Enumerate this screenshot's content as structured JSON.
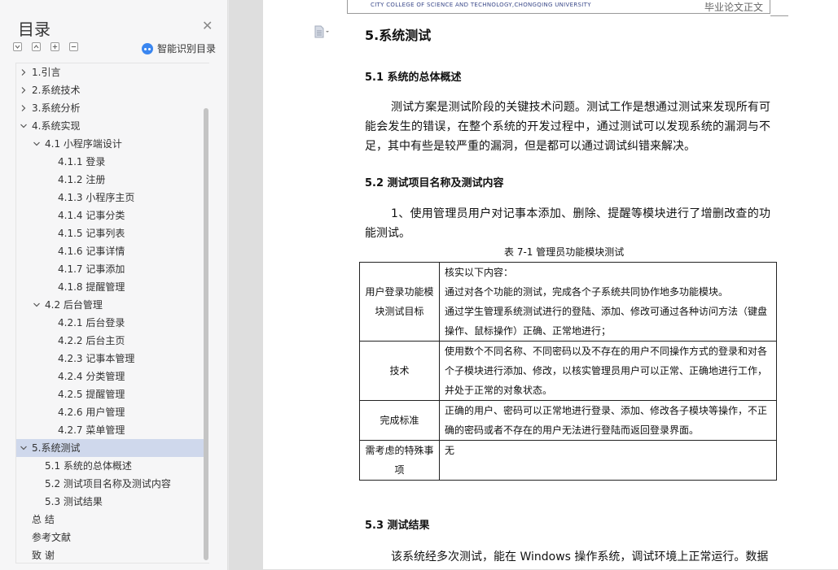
{
  "sidebar": {
    "title": "目录",
    "smart_toc_label": "智能识别目录",
    "toc": [
      {
        "label": "1.引言",
        "level": 1,
        "expandable": true,
        "expanded": false,
        "active": false
      },
      {
        "label": "2.系统技术",
        "level": 1,
        "expandable": true,
        "expanded": false,
        "active": false
      },
      {
        "label": "3.系统分析",
        "level": 1,
        "expandable": true,
        "expanded": false,
        "active": false
      },
      {
        "label": "4.系统实现",
        "level": 1,
        "expandable": true,
        "expanded": true,
        "active": false
      },
      {
        "label": "4.1 小程序端设计",
        "level": 2,
        "expandable": true,
        "expanded": true,
        "active": false
      },
      {
        "label": "4.1.1 登录",
        "level": 3,
        "expandable": false,
        "expanded": false,
        "active": false
      },
      {
        "label": "4.1.2 注册",
        "level": 3,
        "expandable": false,
        "expanded": false,
        "active": false
      },
      {
        "label": "4.1.3 小程序主页",
        "level": 3,
        "expandable": false,
        "expanded": false,
        "active": false
      },
      {
        "label": "4.1.4 记事分类",
        "level": 3,
        "expandable": false,
        "expanded": false,
        "active": false
      },
      {
        "label": "4.1.5 记事列表",
        "level": 3,
        "expandable": false,
        "expanded": false,
        "active": false
      },
      {
        "label": "4.1.6 记事详情",
        "level": 3,
        "expandable": false,
        "expanded": false,
        "active": false
      },
      {
        "label": "4.1.7 记事添加",
        "level": 3,
        "expandable": false,
        "expanded": false,
        "active": false
      },
      {
        "label": "4.1.8 提醒管理",
        "level": 3,
        "expandable": false,
        "expanded": false,
        "active": false
      },
      {
        "label": "4.2 后台管理",
        "level": 2,
        "expandable": true,
        "expanded": true,
        "active": false
      },
      {
        "label": "4.2.1 后台登录",
        "level": 3,
        "expandable": false,
        "expanded": false,
        "active": false
      },
      {
        "label": "4.2.2 后台主页",
        "level": 3,
        "expandable": false,
        "expanded": false,
        "active": false
      },
      {
        "label": "4.2.3 记事本管理",
        "level": 3,
        "expandable": false,
        "expanded": false,
        "active": false
      },
      {
        "label": "4.2.4 分类管理",
        "level": 3,
        "expandable": false,
        "expanded": false,
        "active": false
      },
      {
        "label": "4.2.5 提醒管理",
        "level": 3,
        "expandable": false,
        "expanded": false,
        "active": false
      },
      {
        "label": "4.2.6 用户管理",
        "level": 3,
        "expandable": false,
        "expanded": false,
        "active": false
      },
      {
        "label": "4.2.7 菜单管理",
        "level": 3,
        "expandable": false,
        "expanded": false,
        "active": false
      },
      {
        "label": "5.系统测试",
        "level": 1,
        "expandable": true,
        "expanded": true,
        "active": true
      },
      {
        "label": "5.1 系统的总体概述",
        "level": 2,
        "expandable": false,
        "expanded": false,
        "active": false
      },
      {
        "label": "5.2 测试项目名称及测试内容",
        "level": 2,
        "expandable": false,
        "expanded": false,
        "active": false
      },
      {
        "label": "5.3 测试结果",
        "level": 2,
        "expandable": false,
        "expanded": false,
        "active": false
      },
      {
        "label": "总  结",
        "level": 1,
        "expandable": false,
        "expanded": false,
        "active": false
      },
      {
        "label": "参考文献",
        "level": 1,
        "expandable": false,
        "expanded": false,
        "active": false
      },
      {
        "label": "致  谢",
        "level": 1,
        "expandable": false,
        "expanded": false,
        "active": false
      }
    ]
  },
  "document": {
    "header_left": "CITY COLLEGE OF SCIENCE AND TECHNOLOGY,CHONGQING UNIVERSITY",
    "header_right": "毕业论文正文",
    "h1": "5.系统测试",
    "s51_title": "5.1 系统的总体概述",
    "s51_para": "测试方案是测试阶段的关键技术问题。测试工作是想通过测试来发现所有可能会发生的错误，在整个系统的开发过程中，通过测试可以发现系统的漏洞与不足，其中有些是较严重的漏洞，但是都可以通过调试纠错来解决。",
    "s52_title": "5.2 测试项目名称及测试内容",
    "s52_para": "1、使用管理员用户对记事本添加、删除、提醒等模块进行了增删改查的功能测试。",
    "table_caption": "表 7-1   管理员功能模块测试",
    "table": {
      "r1_key": "用户登录功能模块测试目标",
      "r1_lines": [
        "核实以下内容：",
        "通过对各个功能的测试，完成各个子系统共同协作地多功能模块。",
        "通过学生管理系统测试进行的登陆、添加、修改可通过各种访问方法（键盘操作、鼠标操作）正确、正常地进行；"
      ],
      "r2_key": "技术",
      "r2_value": "使用数个不同名称、不同密码以及不存在的用户不同操作方式的登录和对各个子模块进行添加、修改，以核实管理员用户可以正常、正确地进行工作，并处于正常的对象状态。",
      "r3_key": "完成标准",
      "r3_value": "正确的用户、密码可以正常地进行登录、添加、修改各子模块等操作，不正确的密码或者不存在的用户无法进行登陆而返回登录界面。",
      "r4_key": "需考虑的特殊事项",
      "r4_value": "无"
    },
    "s53_title": "5.3 测试结果",
    "s53_para": "该系统经多次测试，能在 Windows 操作系统，调试环境上正常运行。数据"
  }
}
